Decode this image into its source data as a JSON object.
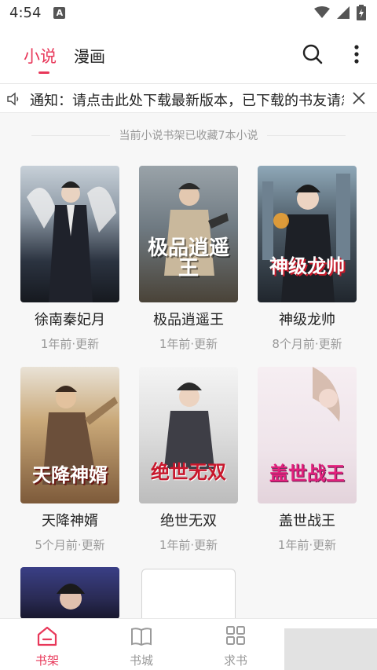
{
  "status_bar": {
    "time": "4:54",
    "badge": "A"
  },
  "header": {
    "tabs": [
      {
        "label": "小说",
        "active": true
      },
      {
        "label": "漫画",
        "active": false
      }
    ],
    "accent_color": "#e8385a"
  },
  "notice": {
    "text": "通知：请点击此处下载最新版本，已下载的书友请忽略"
  },
  "shelf": {
    "summary": "当前小说书架已收藏7本小说",
    "books": [
      {
        "title": "徐南秦妃月",
        "update": "1年前·更新",
        "cover_text": ""
      },
      {
        "title": "极品逍遥王",
        "update": "1年前·更新",
        "cover_text": "极品逍遥王"
      },
      {
        "title": "神级龙帅",
        "update": "8个月前·更新",
        "cover_text": "神级龙帅"
      },
      {
        "title": "天降神婿",
        "update": "5个月前·更新",
        "cover_text": "天降神婿"
      },
      {
        "title": "绝世无双",
        "update": "1年前·更新",
        "cover_text": "绝世无双"
      },
      {
        "title": "盖世战王",
        "update": "1年前·更新",
        "cover_text": "盖世战王"
      }
    ]
  },
  "bottom_nav": {
    "items": [
      {
        "label": "书架",
        "active": true
      },
      {
        "label": "书城",
        "active": false
      },
      {
        "label": "求书",
        "active": false
      }
    ]
  }
}
